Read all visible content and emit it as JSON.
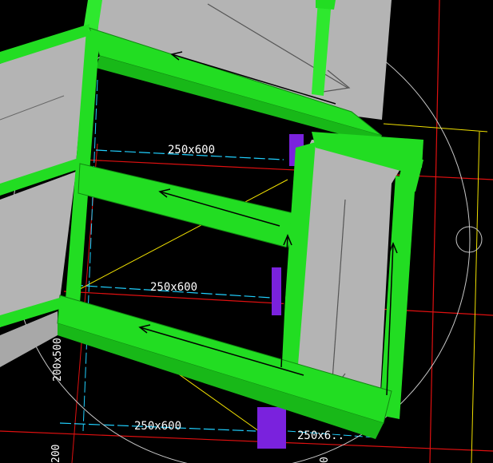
{
  "view": {
    "name": "3D model viewport",
    "background": "#000000",
    "colors": {
      "beam_frame": "#22dd22",
      "beam_face": "#2ee82e",
      "slab": "#b4b4b4",
      "column": "#7a22dd",
      "grid_red": "#e01010",
      "grid_yellow": "#f0e000",
      "dim_cyan": "#20d0ff",
      "orbit_circle": "#c8c8c8",
      "arrow": "#000000"
    }
  },
  "dimensions": {
    "top_beam": "250x600",
    "middle_beam": "250x600",
    "bottom_beam": "250x600",
    "bottom_right_beam": "250x6..",
    "left_vertical_beam": "200x500",
    "bottom_left_vertical": "200",
    "bottom_center_vertical": "0"
  },
  "icons": {
    "orbit": "orbit-circle-icon",
    "beam_direction": "beam-direction-arrow-icon"
  }
}
